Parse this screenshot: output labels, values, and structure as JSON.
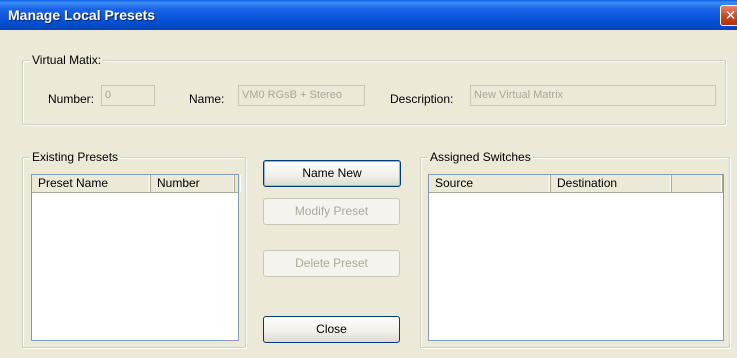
{
  "window": {
    "title": "Manage Local Presets",
    "close_glyph": "✕"
  },
  "virtual_matrix": {
    "legend": "Virtual Matix:",
    "number_label": "Number:",
    "number_value": "0",
    "name_label": "Name:",
    "name_value": "VM0  RGsB + Stereo",
    "description_label": "Description:",
    "description_value": "New Virtual Matrix"
  },
  "existing_presets": {
    "legend": "Existing Presets",
    "columns": [
      "Preset Name",
      "Number",
      ""
    ],
    "rows": []
  },
  "buttons": {
    "name_new": "Name New",
    "modify_preset": "Modify Preset",
    "delete_preset": "Delete Preset",
    "close": "Close"
  },
  "assigned_switches": {
    "legend": "Assigned Switches",
    "columns": [
      "Source",
      "Destination",
      ""
    ],
    "rows": []
  },
  "colors": {
    "title_bar": "#0550d8",
    "dialog_bg": "#ece9d8",
    "disabled_text": "#aca899",
    "list_bg": "#ffffff"
  }
}
